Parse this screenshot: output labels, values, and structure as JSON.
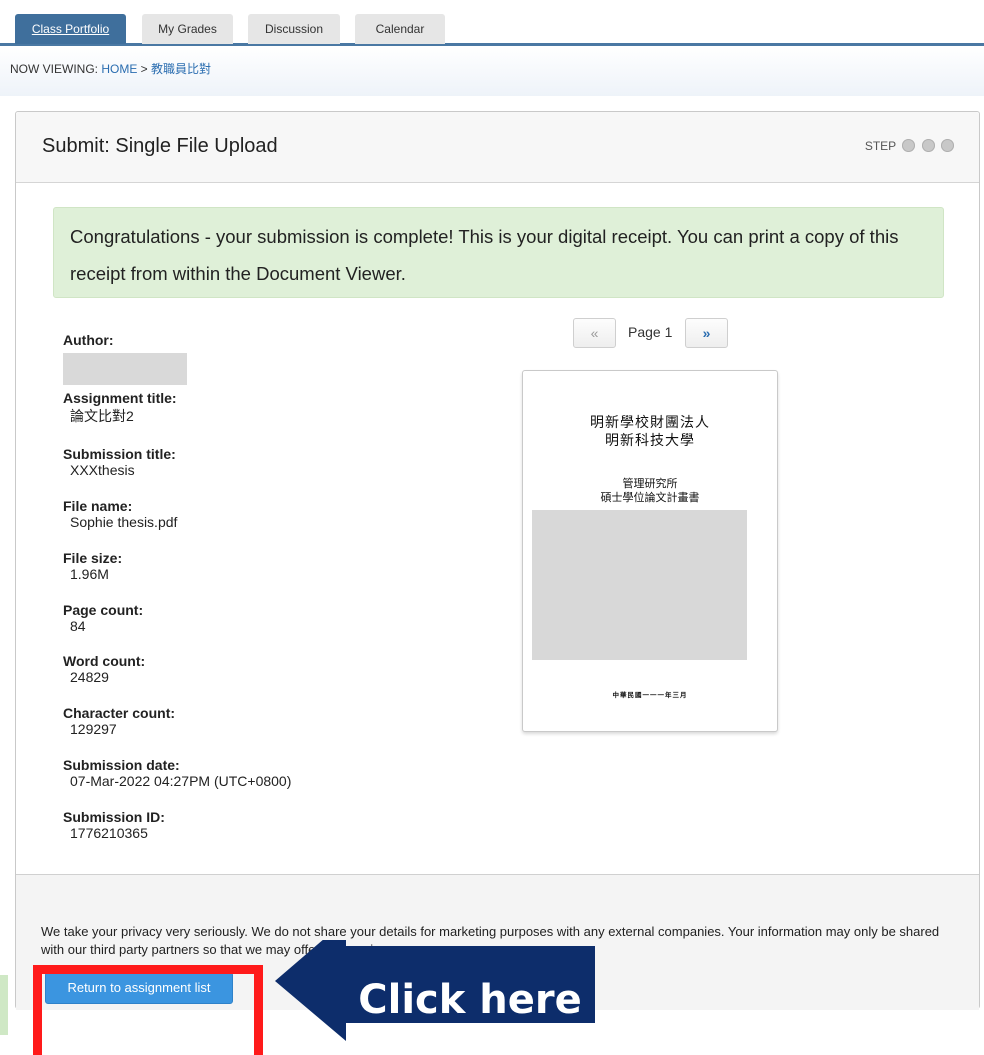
{
  "tabs": [
    {
      "label": "Class Portfolio",
      "active": true
    },
    {
      "label": "My Grades"
    },
    {
      "label": "Discussion"
    },
    {
      "label": "Calendar"
    }
  ],
  "breadcrumb": {
    "prefix": "NOW VIEWING: ",
    "home": "HOME",
    "sep": " > ",
    "current": "教職員比對"
  },
  "panel": {
    "title": "Submit: Single File Upload",
    "step_label": "STEP"
  },
  "success_message": "Congratulations - your submission is complete! This is your digital receipt. You can print a copy of this receipt from within the Document Viewer.",
  "receipt": {
    "author_label": "Author:",
    "fields": [
      {
        "label": "Assignment title:",
        "value": "論文比對2"
      },
      {
        "label": "Submission title:",
        "value": "XXXthesis"
      },
      {
        "label": "File name:",
        "value": "Sophie thesis.pdf"
      },
      {
        "label": "File size:",
        "value": "1.96M"
      },
      {
        "label": "Page count:",
        "value": "84"
      },
      {
        "label": "Word count:",
        "value": "24829"
      },
      {
        "label": "Character count:",
        "value": "129297"
      },
      {
        "label": "Submission date:",
        "value": "07-Mar-2022 04:27PM (UTC+0800)"
      },
      {
        "label": "Submission ID:",
        "value": "1776210365"
      }
    ]
  },
  "viewer": {
    "prev_label": "«",
    "page_label": "Page 1",
    "next_label": "»",
    "doc": {
      "line1": "明新學校財團法人",
      "line2": "明新科技大學",
      "line3": "管理研究所",
      "line4": "碩士學位論文計畫書",
      "date": "中華民國一一一年三月"
    }
  },
  "privacy_text": "We take your privacy very seriously. We do not share your details for marketing purposes with any external companies. Your information may only be shared with our third party partners so that we may offer our service.",
  "return_button": "Return to assignment list",
  "callout": {
    "text": "Click here",
    "color": "#0d2d6b",
    "highlight": "#ff1a1a"
  }
}
